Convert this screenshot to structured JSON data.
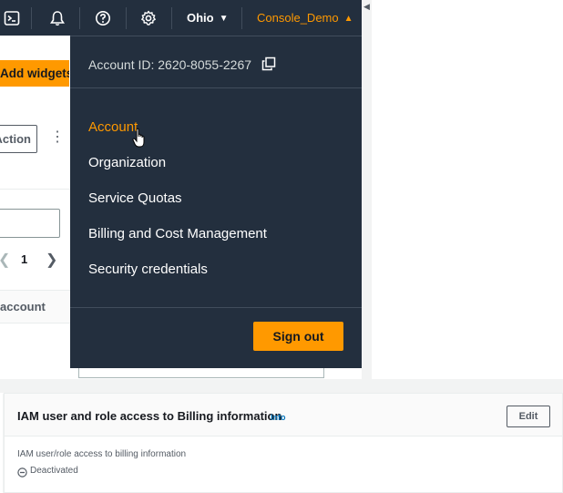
{
  "topnav": {
    "icons": [
      "cloudshell-icon",
      "notifications-icon",
      "help-icon",
      "settings-icon"
    ],
    "region": "Ohio",
    "user": "Console_Demo",
    "background": "#232f3e",
    "accent": "#ff9900"
  },
  "background_page": {
    "widgets_button": "Add widgets",
    "outline_button": "Action",
    "page_number": "1",
    "column_header": "account"
  },
  "account_menu": {
    "account_id_label": "Account ID: 2620-8055-2267",
    "items": [
      {
        "label": "Account",
        "active": true
      },
      {
        "label": "Organization",
        "active": false
      },
      {
        "label": "Service Quotas",
        "active": false
      },
      {
        "label": "Billing and Cost Management",
        "active": false
      },
      {
        "label": "Security credentials",
        "active": false
      }
    ],
    "sign_out_label": "Sign out"
  },
  "billing_access": {
    "title": "IAM user and role access to Billing information",
    "info_link": "Info",
    "edit_label": "Edit",
    "field_label": "IAM user/role access to billing information",
    "status": "Deactivated"
  }
}
